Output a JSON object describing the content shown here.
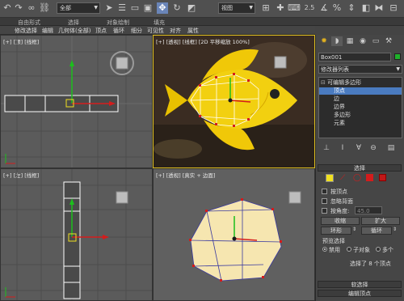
{
  "toolbar": {
    "selection_filter": "全部",
    "reference_coord": "视图",
    "snap_label": "2.5"
  },
  "ribbon": {
    "items": [
      "自由形式",
      "选择",
      "对象绘制",
      "填充"
    ]
  },
  "menubar": {
    "items": [
      "修改选择",
      "编辑",
      "几何体(全部)",
      "顶点",
      "循环",
      "细分",
      "可见性",
      "对齐",
      "属性"
    ]
  },
  "viewports": {
    "top_label": "[+] [顶] [线框]",
    "persp_label": "[+] [透视] [线框] [2D 平移缩放 100%]",
    "left_label": "[+] [左] [线框]",
    "persp2_label": "[+] [透视] [真实 + 边面]"
  },
  "cmdpanel": {
    "object_name": "Box001",
    "modifier_list_label": "修改器列表",
    "stack": {
      "modifier": "可编辑多边形",
      "subitems": [
        "顶点",
        "边",
        "边界",
        "多边形",
        "元素"
      ],
      "selected_index": 0
    },
    "selection": {
      "title": "选择",
      "by_vertex": "按顶点",
      "ignore_backfacing": "忽略背面",
      "by_angle": "按角度:",
      "angle_value": "45.0",
      "shrink": "收缩",
      "grow": "扩大",
      "ring": "环形",
      "loop": "循环",
      "preview_title": "预览选择",
      "preview_options": [
        "禁用",
        "子对象",
        "多个"
      ],
      "preview_selected": 0,
      "status": "选择了 8 个顶点"
    },
    "soft_selection_title": "软选择",
    "edit_vertices_title": "编辑顶点"
  },
  "colors": {
    "object_swatch": "#1fb02a",
    "selection_highlight": "#4a7bc0",
    "active_viewport_border": "#e0c020"
  }
}
